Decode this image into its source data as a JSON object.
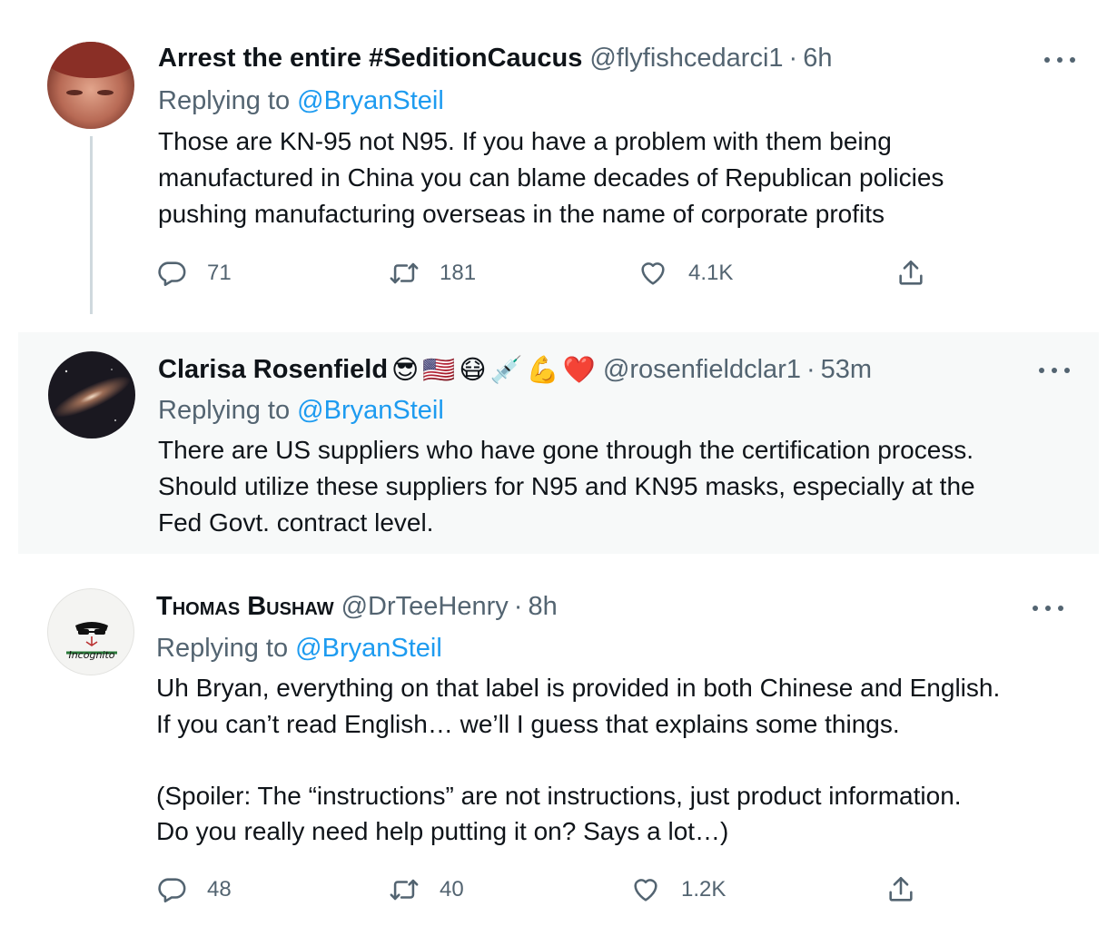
{
  "tweets": [
    {
      "name": "Arrest the entire #SeditionCaucus",
      "handle": "@flyfishcedarci1",
      "separator": "·",
      "time": "6h",
      "reply_prefix": "Replying to",
      "reply_mention": "@BryanSteil",
      "text": "Those are KN-95 not N95. If you have a problem with them being\nmanufactured in China you can blame decades of Republican policies\npushing manufacturing overseas in the name of corporate profits",
      "replies": "71",
      "retweets": "181",
      "likes": "4.1K"
    },
    {
      "name": "Clarisa Rosenfield",
      "emojis": [
        "😎",
        "🇺🇸",
        "😷",
        "💉",
        "💪",
        "❤️"
      ],
      "handle": "@rosenfieldclar1",
      "separator": "·",
      "time": "53m",
      "reply_prefix": "Replying to",
      "reply_mention": "@BryanSteil",
      "text": "There are US suppliers who have gone through the certification process.\nShould utilize these suppliers for N95 and KN95 masks, especially at the\nFed Govt. contract level."
    },
    {
      "name": "Thomas Bushaw",
      "handle": "@DrTeeHenry",
      "separator": "·",
      "time": "8h",
      "reply_prefix": "Replying to",
      "reply_mention": "@BryanSteil",
      "avatar_text": "Incognito",
      "text": "Uh Bryan, everything on that label is provided in both Chinese and English.\nIf you can’t read English… we’ll I guess that explains some things.\n\n(Spoiler: The “instructions” are not instructions, just product information.\nDo you really need help putting it on? Says a lot…)",
      "replies": "48",
      "retweets": "40",
      "likes": "1.2K"
    }
  ],
  "icons": {
    "reply": "reply-icon",
    "retweet": "retweet-icon",
    "like": "heart-icon",
    "share": "share-icon",
    "more": "more-options-icon"
  },
  "colors": {
    "accent": "#1d9bf0",
    "secondary_text": "#536471",
    "primary_text": "#0f1419"
  }
}
